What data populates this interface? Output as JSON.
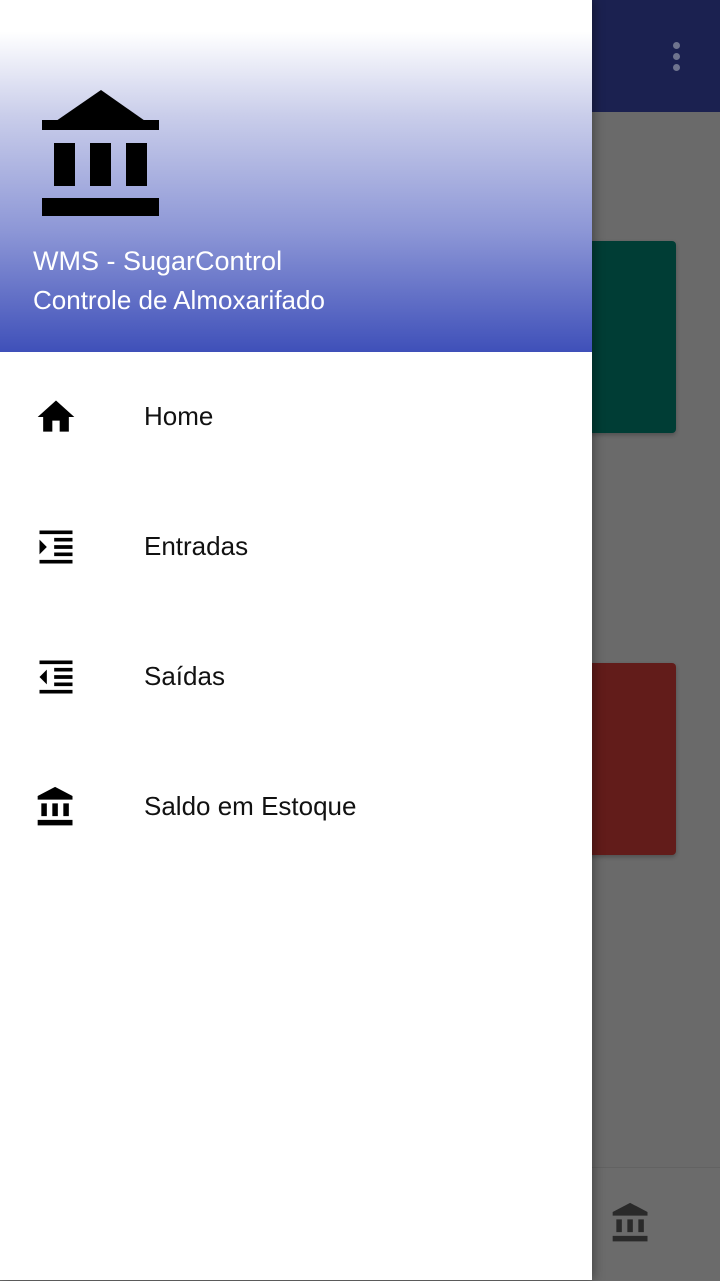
{
  "background": {
    "toolbar_color": "#1b2150",
    "overflow_icon": "more-vert-icon",
    "cards": [
      {
        "color": "#003d35"
      },
      {
        "color": "#621c1a"
      }
    ],
    "bottom_nav_icon": "bank-icon"
  },
  "drawer": {
    "header": {
      "logo_icon": "bank-icon",
      "title": "WMS - SugarControl",
      "subtitle": "Controle de Almoxarifado",
      "gradient": [
        "#ffffff",
        "#3f50b9"
      ]
    },
    "items": [
      {
        "label": "Home",
        "icon": "home-icon"
      },
      {
        "label": "Entradas",
        "icon": "format-indent-increase-icon"
      },
      {
        "label": "Saídas",
        "icon": "format-indent-decrease-icon"
      },
      {
        "label": "Saldo em Estoque",
        "icon": "bank-icon"
      }
    ]
  }
}
